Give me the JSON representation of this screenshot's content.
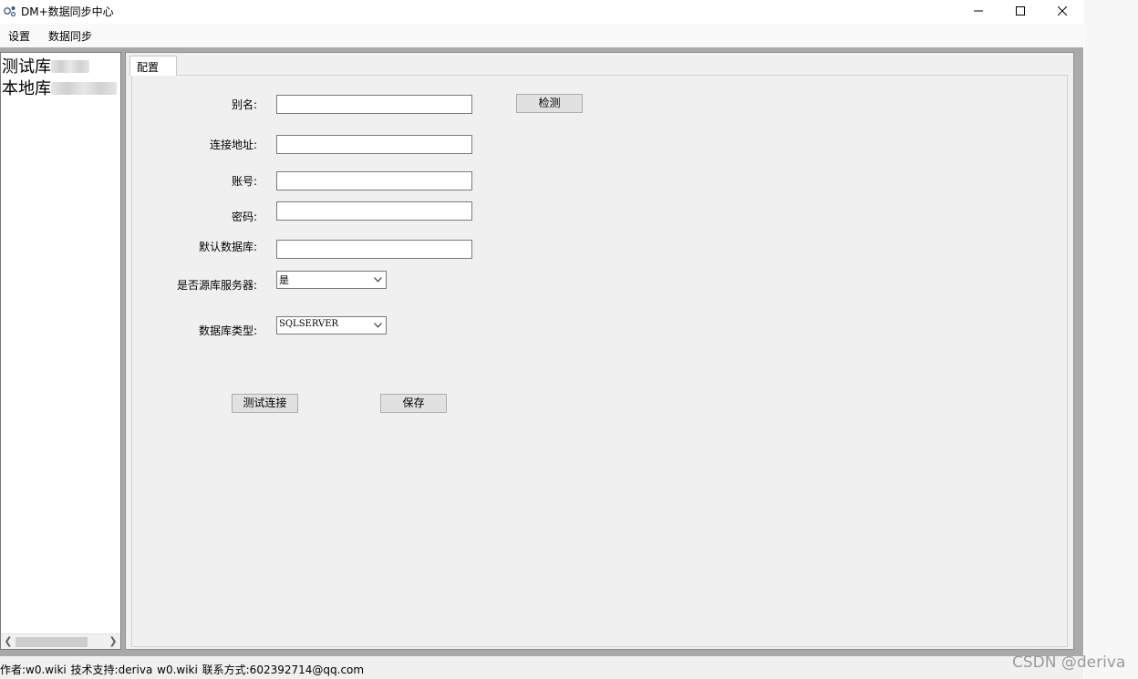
{
  "window": {
    "title": "DM+数据同步中心"
  },
  "menu": {
    "settings": "设置",
    "data_sync": "数据同步"
  },
  "tree": {
    "items": [
      "测试库",
      "本地库"
    ]
  },
  "tabs": [
    {
      "label": "配置"
    }
  ],
  "form": {
    "alias_label": "别名:",
    "alias_value": "",
    "detect_button": "检测",
    "address_label": "连接地址:",
    "address_value": "",
    "account_label": "账号:",
    "account_value": "",
    "password_label": "密码:",
    "password_value": "",
    "default_db_label": "默认数据库:",
    "default_db_value": "",
    "source_server_label": "是否源库服务器:",
    "source_server_value": "是",
    "db_type_label": "数据库类型:",
    "db_type_value": "SQLSERVER",
    "test_button": "测试连接",
    "save_button": "保存"
  },
  "status": {
    "text": "作者:w0.wiki  技术支持:deriva  w0.wiki  联系方式:602392714@qq.com"
  },
  "watermark": "CSDN @deriva",
  "icons": {
    "minimize": "minimize-icon",
    "maximize": "maximize-icon",
    "close": "close-icon",
    "dropdown": "chevron-down-icon",
    "app": "app-icon"
  }
}
